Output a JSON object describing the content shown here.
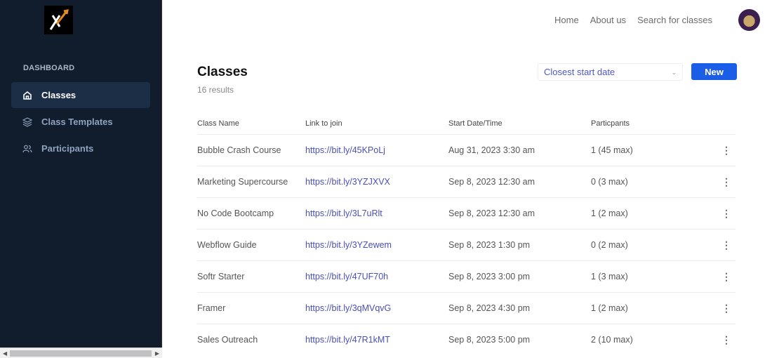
{
  "sidebar": {
    "section": "DASHBOARD",
    "items": [
      {
        "label": "Classes",
        "icon": "home-icon"
      },
      {
        "label": "Class Templates",
        "icon": "layers-icon"
      },
      {
        "label": "Participants",
        "icon": "users-icon"
      }
    ]
  },
  "topnav": {
    "links": [
      "Home",
      "About us",
      "Search for classes"
    ]
  },
  "page": {
    "title": "Classes",
    "count": "16 results",
    "sort": "Closest start date",
    "new_label": "New"
  },
  "table": {
    "headers": [
      "Class Name",
      "Link to join",
      "Start Date/Time",
      "Particpants"
    ],
    "rows": [
      [
        "Bubble Crash Course",
        "https://bit.ly/45KPoLj",
        "Aug 31, 2023 3:30 am",
        "1 (45 max)"
      ],
      [
        "Marketing Supercourse",
        "https://bit.ly/3YZJXVX",
        "Sep 8, 2023 12:30 am",
        "0 (3 max)"
      ],
      [
        "No Code Bootcamp",
        "https://bit.ly/3L7uRlt",
        "Sep 8, 2023 12:30 am",
        "1 (2 max)"
      ],
      [
        "Webflow Guide",
        "https://bit.ly/3YZewem",
        "Sep 8, 2023 1:30 pm",
        "0 (2 max)"
      ],
      [
        "Softr Starter",
        "https://bit.ly/47UF70h",
        "Sep 8, 2023 3:00 pm",
        "1 (3 max)"
      ],
      [
        "Framer",
        "https://bit.ly/3qMVqvG",
        "Sep 8, 2023 4:30 pm",
        "1 (2 max)"
      ],
      [
        "Sales Outreach",
        "https://bit.ly/47R1kMT",
        "Sep 8, 2023 5:00 pm",
        "2 (10 max)"
      ]
    ]
  }
}
